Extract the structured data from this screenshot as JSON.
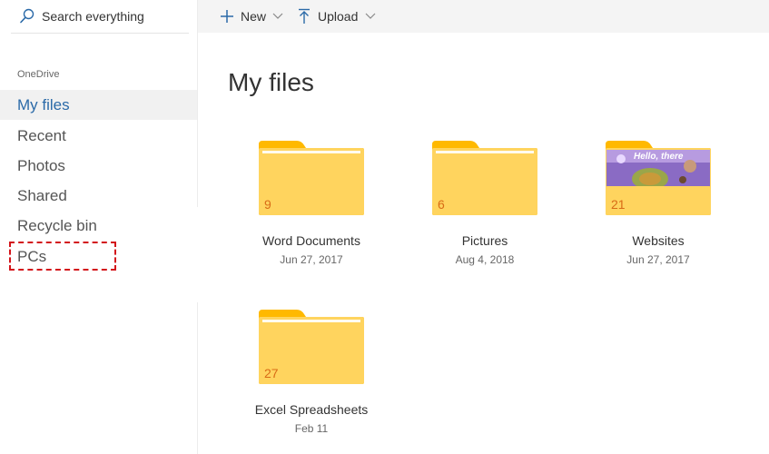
{
  "search": {
    "label": "Search everything"
  },
  "sidebar": {
    "section": "OneDrive",
    "items": [
      {
        "label": "My files",
        "active": true
      },
      {
        "label": "Recent"
      },
      {
        "label": "Photos"
      },
      {
        "label": "Shared"
      },
      {
        "label": "Recycle bin"
      },
      {
        "label": "PCs",
        "highlighted": true
      }
    ]
  },
  "commandbar": {
    "new_label": "New",
    "upload_label": "Upload"
  },
  "main": {
    "title": "My files",
    "folders": [
      {
        "name": "Word Documents",
        "count": "9",
        "date": "Jun 27, 2017"
      },
      {
        "name": "Pictures",
        "count": "6",
        "date": "Aug 4, 2018"
      },
      {
        "name": "Websites",
        "count": "21",
        "date": "Jun 27, 2017",
        "thumbnail_text": "Hello, there"
      },
      {
        "name": "Excel Spreadsheets",
        "count": "27",
        "date": "Feb 11"
      }
    ]
  },
  "colors": {
    "folder_body": "#ffd45e",
    "folder_tab": "#ffb900",
    "count_text": "#d86b16",
    "accent": "#2b6aa8",
    "highlight_border": "#d3141a"
  },
  "icons": {
    "search": "search-icon",
    "new": "plus-icon",
    "upload": "upload-arrow-icon",
    "dropdown": "chevron-down-icon"
  }
}
